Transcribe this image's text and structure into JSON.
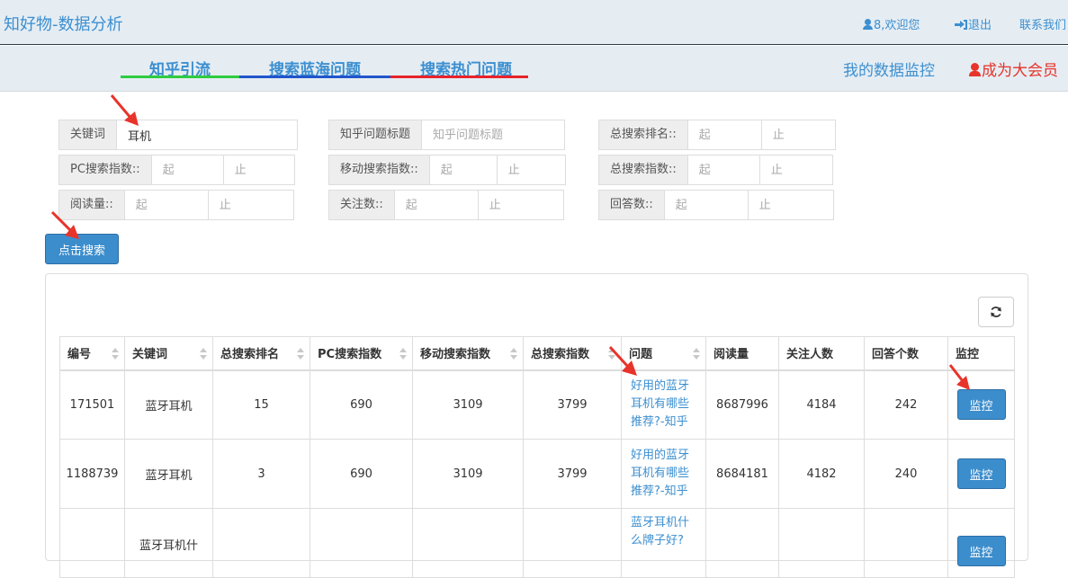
{
  "header": {
    "brand": "知好物-数据分析",
    "user_greeting": "8,欢迎您",
    "logout": "退出",
    "contact": "联系我们"
  },
  "subnav": {
    "tabs": [
      {
        "label": "知乎引流",
        "color": "#2ecc40"
      },
      {
        "label": "搜索蓝海问题",
        "color": "#2255cc"
      },
      {
        "label": "搜索热门问题",
        "color": "#e8232a"
      }
    ],
    "my_monitor": "我的数据监控",
    "become_vip": "成为大会员"
  },
  "filters": {
    "keyword": {
      "label": "关键词",
      "value": "耳机"
    },
    "question_title": {
      "label": "知乎问题标题",
      "placeholder": "知乎问题标题"
    },
    "total_rank": {
      "label": "总搜索排名::",
      "from": "起",
      "to": "止"
    },
    "pc_index": {
      "label": "PC搜索指数::",
      "from": "起",
      "to": "止"
    },
    "mobile_index": {
      "label": "移动搜索指数::",
      "from": "起",
      "to": "止"
    },
    "total_index": {
      "label": "总搜索指数::",
      "from": "起",
      "to": "止"
    },
    "reads": {
      "label": "阅读量::",
      "from": "起",
      "to": "止"
    },
    "follows": {
      "label": "关注数::",
      "from": "起",
      "to": "止"
    },
    "answers": {
      "label": "回答数::",
      "from": "起",
      "to": "止"
    },
    "search_button": "点击搜索"
  },
  "table": {
    "columns": [
      "编号",
      "关键词",
      "总搜索排名",
      "PC搜索指数",
      "移动搜索指数",
      "总搜索指数",
      "问题",
      "阅读量",
      "关注人数",
      "回答个数",
      "监控"
    ],
    "rows": [
      {
        "id": "171501",
        "keyword": "蓝牙耳机",
        "rank": "15",
        "pc": "690",
        "mobile": "3109",
        "total": "3799",
        "question": [
          "好用的蓝牙",
          "耳机有哪些",
          "推荐?-知乎"
        ],
        "reads": "8687996",
        "follows": "4184",
        "answers": "242",
        "action": "监控"
      },
      {
        "id": "1188739",
        "keyword": "蓝牙耳机",
        "rank": "3",
        "pc": "690",
        "mobile": "3109",
        "total": "3799",
        "question": [
          "好用的蓝牙",
          "耳机有哪些",
          "推荐?-知乎"
        ],
        "reads": "8684181",
        "follows": "4182",
        "answers": "240",
        "action": "监控"
      },
      {
        "id": "",
        "keyword": "蓝牙耳机什",
        "rank": "",
        "pc": "",
        "mobile": "",
        "total": "",
        "question": [
          "蓝牙耳机什",
          "么牌子好?"
        ],
        "reads": "",
        "follows": "",
        "answers": "",
        "action": "监控"
      }
    ]
  }
}
